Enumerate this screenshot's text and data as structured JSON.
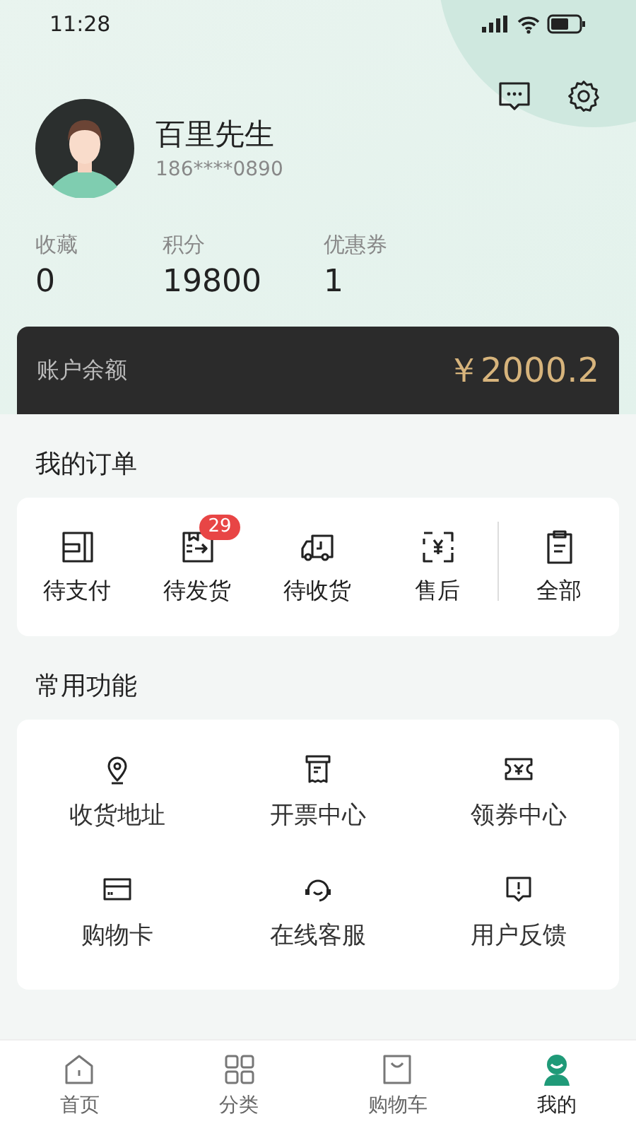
{
  "status_bar": {
    "time": "11:28"
  },
  "profile": {
    "name": "百里先生",
    "phone": "186****0890"
  },
  "stats": [
    {
      "label": "收藏",
      "value": "0"
    },
    {
      "label": "积分",
      "value": "19800"
    },
    {
      "label": "优惠券",
      "value": "1"
    }
  ],
  "balance": {
    "label": "账户余额",
    "amount": "￥2000.2"
  },
  "orders": {
    "title": "我的订单",
    "items": [
      {
        "label": "待支付"
      },
      {
        "label": "待发货",
        "badge": "29"
      },
      {
        "label": "待收货"
      },
      {
        "label": "售后"
      },
      {
        "label": "全部"
      }
    ]
  },
  "functions": {
    "title": "常用功能",
    "items": [
      {
        "label": "收货地址"
      },
      {
        "label": "开票中心"
      },
      {
        "label": "领券中心"
      },
      {
        "label": "购物卡"
      },
      {
        "label": "在线客服"
      },
      {
        "label": "用户反馈"
      }
    ]
  },
  "tab_bar": [
    {
      "label": "首页",
      "selected": false
    },
    {
      "label": "分类",
      "selected": false
    },
    {
      "label": "购物车",
      "selected": false
    },
    {
      "label": "我的",
      "selected": true
    }
  ]
}
